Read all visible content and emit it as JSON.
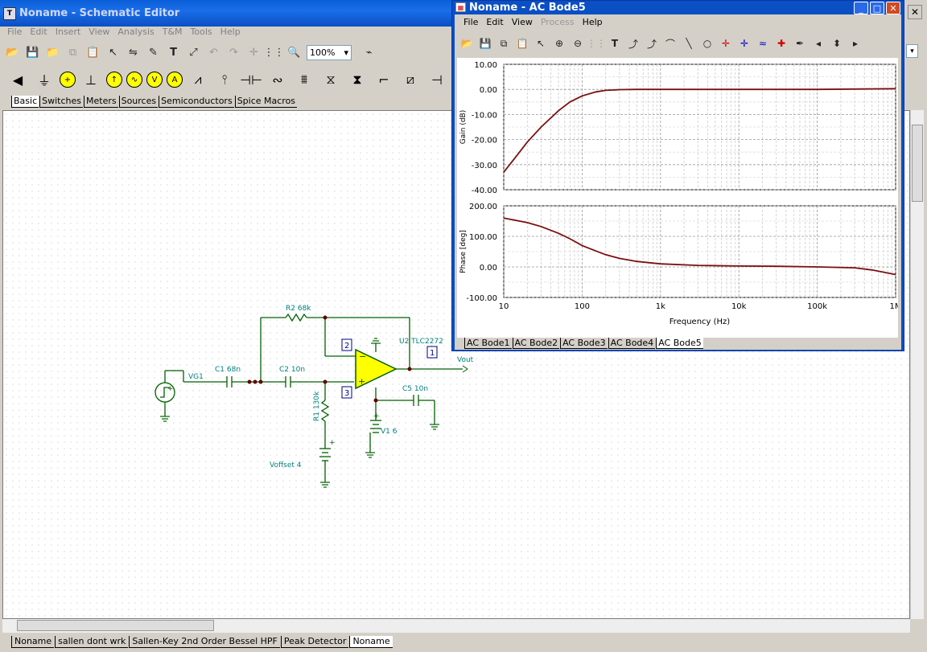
{
  "main_window": {
    "title": "Noname - Schematic Editor",
    "menu": [
      "File",
      "Edit",
      "Insert",
      "View",
      "Analysis",
      "T&M",
      "Tools",
      "Help"
    ],
    "zoom": "100%",
    "component_tabs": [
      "Basic",
      "Switches",
      "Meters",
      "Sources",
      "Semiconductors",
      "Spice Macros"
    ],
    "active_component_tab": "Basic",
    "document_tabs": [
      "Noname",
      "sallen dont wrk",
      "Sallen-Key 2nd Order Bessel HPF",
      "Peak Detector",
      "Noname"
    ],
    "active_document_tab": "Noname"
  },
  "schematic": {
    "labels": {
      "r2": "R2 68k",
      "c1": "C1 68n",
      "c2": "C2 10n",
      "vg1": "VG1",
      "r1": "R1 130k",
      "voffset": "Voffset 4",
      "u2": "U2 TLC2272",
      "c5": "C5 10n",
      "v1": "V1 6",
      "vout": "Vout",
      "pin1": "1",
      "pin2": "2",
      "pin3": "3"
    }
  },
  "bode_window": {
    "title": "Noname - AC Bode5",
    "menu": [
      "File",
      "Edit",
      "View",
      "Process",
      "Help"
    ],
    "disabled_menu": "Process",
    "tabs": [
      "AC Bode1",
      "AC Bode2",
      "AC Bode3",
      "AC Bode4",
      "AC Bode5"
    ],
    "active_tab": "AC Bode5"
  },
  "chart_data": [
    {
      "type": "line",
      "title": "",
      "ylabel": "Gain (dB)",
      "xlabel": "",
      "xscale": "log",
      "xlim": [
        10,
        1000000
      ],
      "ylim": [
        -40,
        10
      ],
      "yticks": [
        "10.00",
        "0.00",
        "-10.00",
        "-20.00",
        "-30.00",
        "-40.00"
      ],
      "grid": true,
      "series": [
        {
          "color": "#7a1010",
          "x": [
            10,
            15,
            20,
            30,
            50,
            70,
            100,
            150,
            200,
            300,
            500,
            1000,
            10000,
            100000,
            1000000
          ],
          "y": [
            -33,
            -26,
            -21,
            -15,
            -8.5,
            -5,
            -2.6,
            -1,
            -0.4,
            -0.1,
            0,
            0,
            0,
            0,
            0.3
          ]
        }
      ]
    },
    {
      "type": "line",
      "title": "",
      "ylabel": "Phase [deg]",
      "xlabel": "Frequency (Hz)",
      "xscale": "log",
      "xlim": [
        10,
        1000000
      ],
      "ylim": [
        -100,
        200
      ],
      "yticks": [
        "200.00",
        "100.00",
        "0.00",
        "-100.00"
      ],
      "xticks": [
        "10",
        "100",
        "1k",
        "10k",
        "100k",
        "1M"
      ],
      "grid": true,
      "series": [
        {
          "color": "#7a1010",
          "x": [
            10,
            20,
            30,
            50,
            70,
            100,
            150,
            200,
            300,
            500,
            1000,
            3000,
            10000,
            30000,
            100000,
            300000,
            500000,
            1000000
          ],
          "y": [
            160,
            145,
            132,
            110,
            92,
            70,
            52,
            40,
            28,
            18,
            10,
            5,
            3,
            2,
            0,
            -3,
            -10,
            -25
          ]
        }
      ]
    }
  ]
}
